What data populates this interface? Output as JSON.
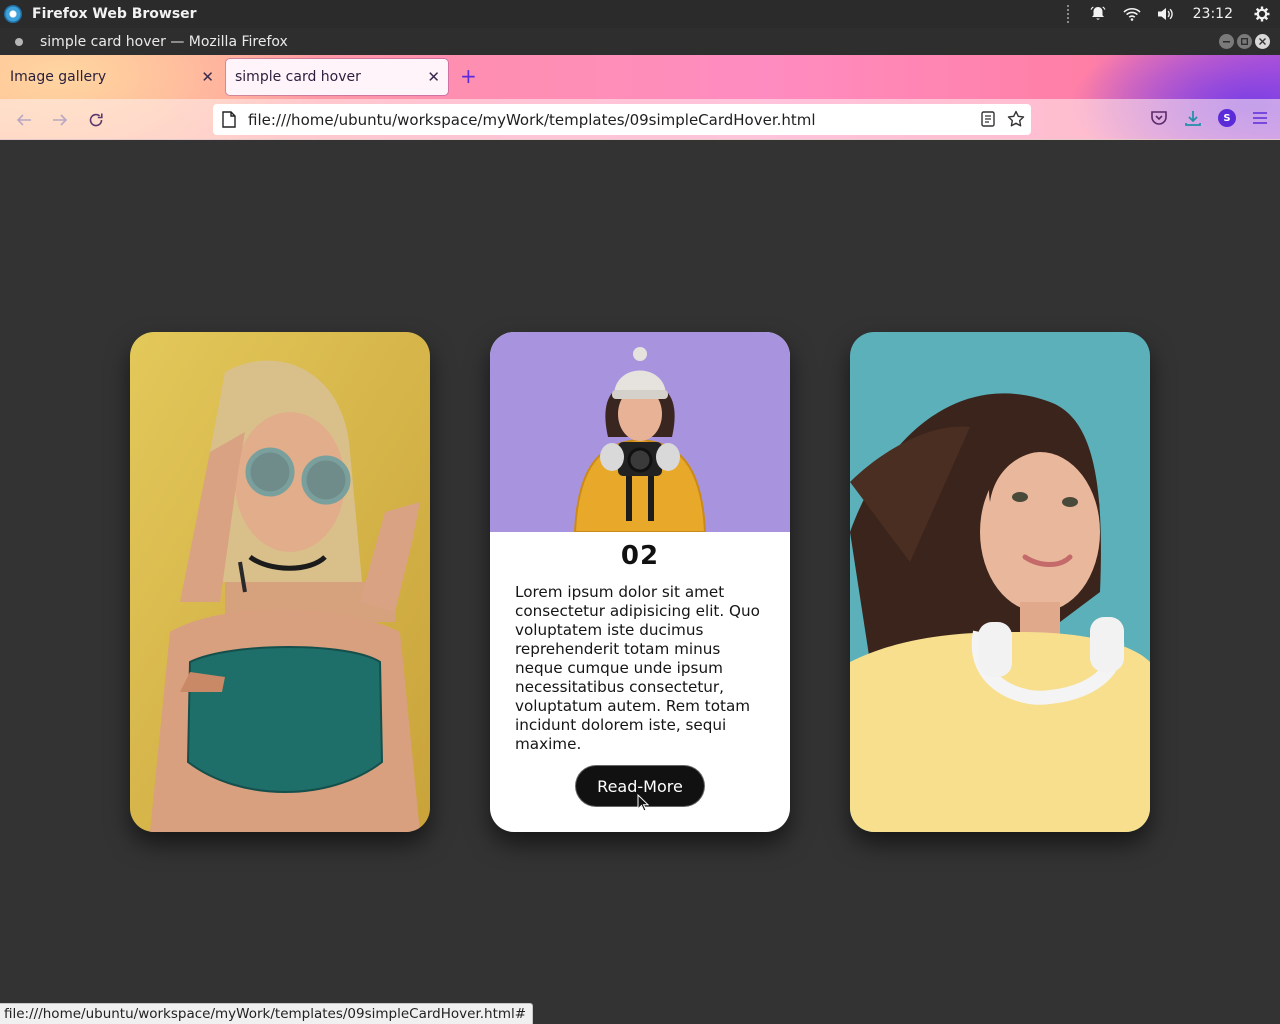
{
  "system": {
    "app_name": "Firefox Web Browser",
    "clock": "23:12"
  },
  "window": {
    "title": "simple card hover — Mozilla Firefox"
  },
  "tabs": [
    {
      "label": "Image gallery",
      "active": false
    },
    {
      "label": "simple card hover",
      "active": true
    }
  ],
  "navbar": {
    "url": "file:///home/ubuntu/workspace/myWork/templates/09simpleCardHover.html",
    "account_initial": "S"
  },
  "cards": {
    "middle": {
      "number": "02",
      "text": "Lorem ipsum dolor sit amet consectetur adipisicing elit. Quo voluptatem iste ducimus reprehenderit totam minus neque cumque unde ipsum necessitatibus consectetur, voluptatum autem. Rem totam incidunt dolorem iste, sequi maxime.",
      "button_label": "Read-More"
    }
  },
  "status": {
    "link_preview": "file:///home/ubuntu/workspace/myWork/templates/09simpleCardHover.html#"
  },
  "colors": {
    "page_background": "#333333",
    "card_background": "#ffffff",
    "button_background": "#111111",
    "firefox_accent": "#5b2bd9"
  }
}
